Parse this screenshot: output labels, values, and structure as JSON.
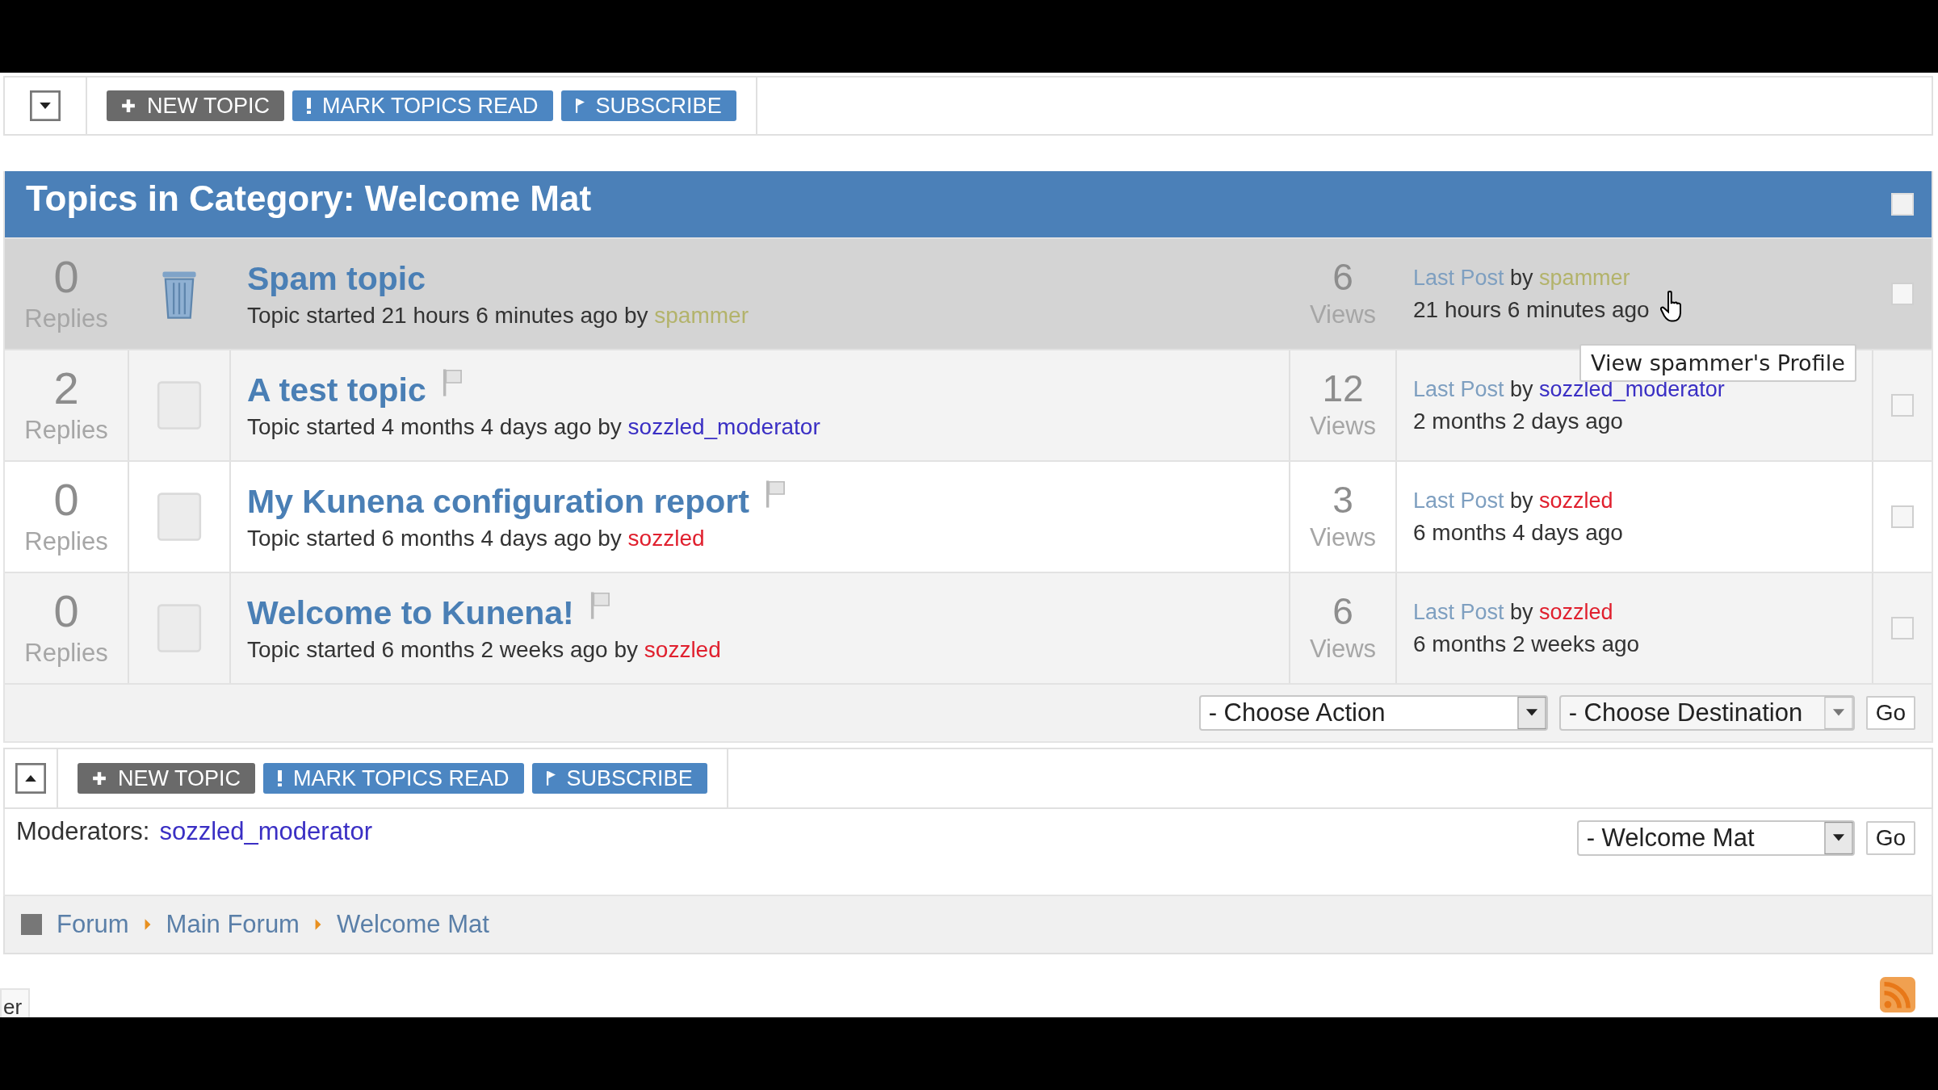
{
  "toolbars": [
    {
      "expanded": false,
      "buttons": [
        {
          "kind": "new",
          "label": "NEW TOPIC"
        },
        {
          "kind": "mark",
          "label": "MARK TOPICS READ"
        },
        {
          "kind": "subscribe",
          "label": "SUBSCRIBE"
        }
      ]
    },
    {
      "expanded": true,
      "buttons": [
        {
          "kind": "new",
          "label": "NEW TOPIC"
        },
        {
          "kind": "mark",
          "label": "MARK TOPICS READ"
        },
        {
          "kind": "subscribe",
          "label": "SUBSCRIBE"
        }
      ]
    }
  ],
  "category": {
    "title": "Topics in Category: Welcome Mat",
    "checked": false
  },
  "topics": [
    {
      "replies": "0",
      "replies_label": "Replies",
      "kind": "trash",
      "title": "Spam topic",
      "flag": false,
      "started": "Topic started 21 hours 6 minutes ago",
      "by": "by",
      "author": {
        "name": "spammer",
        "color": "#b3b36b"
      },
      "views": "6",
      "views_label": "Views",
      "last_post_label": "Last Post",
      "last_by": "by",
      "last_author": {
        "name": "spammer",
        "color": "#b3b36b"
      },
      "last_time": "21 hours 6 minutes ago",
      "highlighted": true,
      "checked": false
    },
    {
      "replies": "2",
      "replies_label": "Replies",
      "kind": "page",
      "title": "A test topic",
      "flag": true,
      "started": "Topic started 4 months 4 days ago",
      "by": "by",
      "author": {
        "name": "sozzled_moderator",
        "color": "#3a2fc4"
      },
      "views": "12",
      "views_label": "Views",
      "last_post_label": "Last Post",
      "last_by": "by",
      "last_author": {
        "name": "sozzled_moderator",
        "color": "#3a2fc4"
      },
      "last_time": "2 months 2 days ago",
      "highlighted": false,
      "checked": false
    },
    {
      "replies": "0",
      "replies_label": "Replies",
      "kind": "page",
      "title": "My Kunena configuration report",
      "flag": true,
      "started": "Topic started 6 months 4 days ago",
      "by": "by",
      "author": {
        "name": "sozzled",
        "color": "#e0202e"
      },
      "views": "3",
      "views_label": "Views",
      "last_post_label": "Last Post",
      "last_by": "by",
      "last_author": {
        "name": "sozzled",
        "color": "#e0202e"
      },
      "last_time": "6 months 4 days ago",
      "highlighted": false,
      "checked": false
    },
    {
      "replies": "0",
      "replies_label": "Replies",
      "kind": "page",
      "title": "Welcome to Kunena!",
      "flag": true,
      "started": "Topic started 6 months 2 weeks ago",
      "by": "by",
      "author": {
        "name": "sozzled",
        "color": "#e0202e"
      },
      "views": "6",
      "views_label": "Views",
      "last_post_label": "Last Post",
      "last_by": "by",
      "last_author": {
        "name": "sozzled",
        "color": "#e0202e"
      },
      "last_time": "6 months 2 weeks ago",
      "highlighted": false,
      "checked": false
    }
  ],
  "tooltip": {
    "text": "View spammer's Profile"
  },
  "actions": {
    "action_select": "- Choose Action",
    "destination_select": "- Choose Destination",
    "go": "Go"
  },
  "moderators": {
    "label": "Moderators:",
    "names": [
      "sozzled_moderator"
    ]
  },
  "jump": {
    "select": "- Welcome Mat",
    "go": "Go"
  },
  "breadcrumb": [
    {
      "label": "Forum"
    },
    {
      "label": "Main Forum"
    },
    {
      "label": "Welcome Mat"
    }
  ],
  "footer_tab": "er"
}
